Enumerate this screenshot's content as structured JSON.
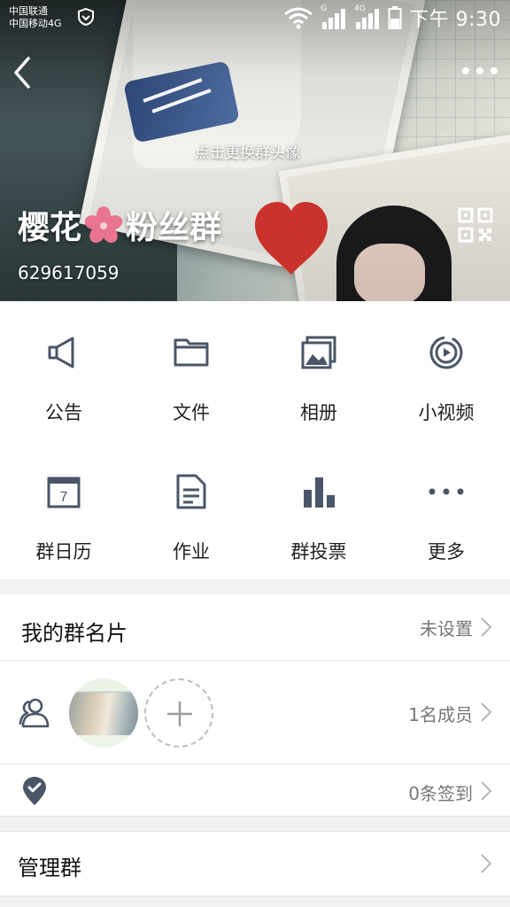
{
  "status_bar": {
    "carrier_1": "中国联通",
    "carrier_2": "中国移动4G",
    "signal_1_label": "G",
    "signal_2_label": "4G",
    "time": "下午 9:30"
  },
  "header": {
    "change_avatar_hint": "点击更换群头像",
    "group_name_part1": "樱花",
    "group_name_part2": "粉丝群",
    "group_id": "629617059"
  },
  "features": [
    {
      "label": "公告",
      "icon": "megaphone-icon"
    },
    {
      "label": "文件",
      "icon": "folder-icon"
    },
    {
      "label": "相册",
      "icon": "photo-album-icon"
    },
    {
      "label": "小视频",
      "icon": "video-play-icon"
    },
    {
      "label": "群日历",
      "icon": "calendar-icon"
    },
    {
      "label": "作业",
      "icon": "document-icon"
    },
    {
      "label": "群投票",
      "icon": "bar-chart-icon"
    },
    {
      "label": "更多",
      "icon": "more-dots-icon"
    }
  ],
  "calendar_day": "7",
  "group_card": {
    "title": "我的群名片",
    "value": "未设置"
  },
  "members": {
    "count_text": "1名成员"
  },
  "checkin": {
    "count_text": "0条签到"
  },
  "manage": {
    "title": "管理群"
  },
  "colors": {
    "icon": "#4a5568",
    "heart": "#c9332b",
    "divider": "#e1e1e4",
    "section_gap": "#f2f2f4"
  }
}
